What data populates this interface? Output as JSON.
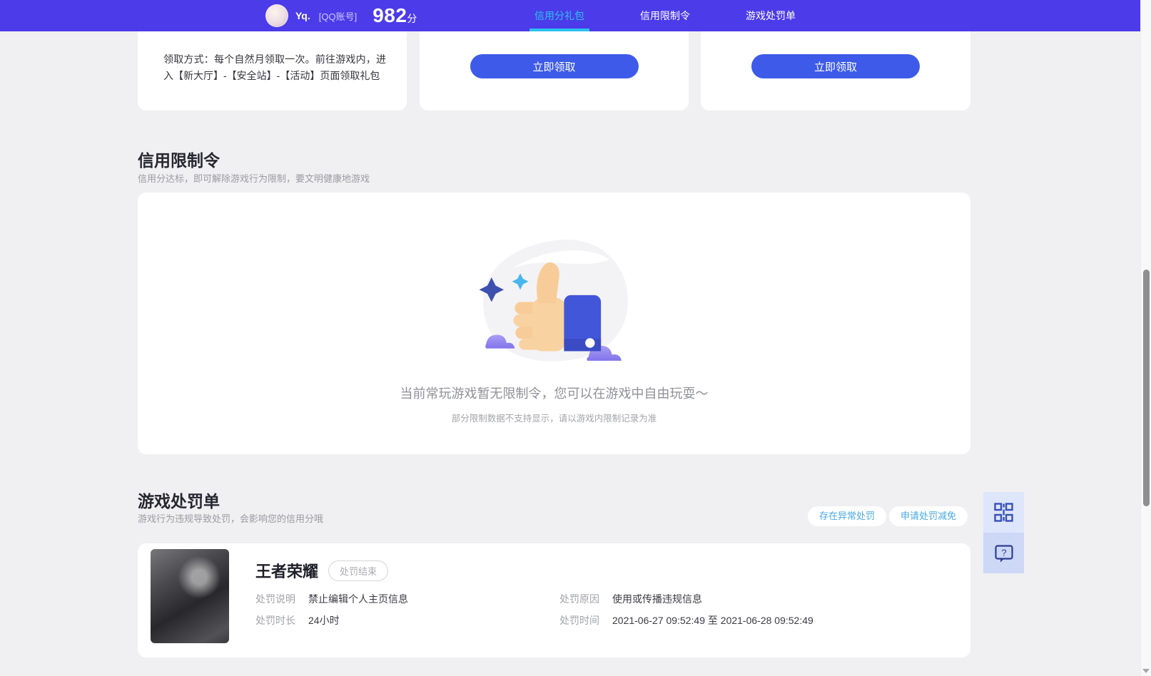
{
  "header": {
    "user": {
      "name": "Yq.",
      "account_type": "[QQ账号]",
      "score": "982",
      "score_unit": "分"
    },
    "tabs": [
      {
        "label": "信用分礼包",
        "active": true
      },
      {
        "label": "信用限制令",
        "active": false
      },
      {
        "label": "游戏处罚单",
        "active": false
      }
    ]
  },
  "gift": {
    "claim_instructions": "领取方式：每个自然月领取一次。前往游戏内，进入【新大厅】-【安全站】-【活动】页面领取礼包",
    "claim_button_label": "立即领取"
  },
  "restriction": {
    "title": "信用限制令",
    "subtitle": "信用分达标，即可解除游戏行为限制，要文明健康地游戏",
    "empty_message": "当前常玩游戏暂无限制令，您可以在游戏中自由玩耍～",
    "empty_note": "部分限制数据不支持显示，请以游戏内限制记录为准"
  },
  "penalty": {
    "title": "游戏处罚单",
    "subtitle": "游戏行为违规导致处罚，会影响您的信用分哦",
    "actions": [
      {
        "label": "存在异常处罚"
      },
      {
        "label": "申请处罚减免"
      }
    ],
    "card": {
      "game_name": "王者荣耀",
      "status_badge": "处罚结束",
      "fields": [
        {
          "label": "处罚说明",
          "value": "禁止编辑个人主页信息"
        },
        {
          "label": "处罚原因",
          "value": "使用或传播违规信息"
        },
        {
          "label": "处罚时长",
          "value": "24小时"
        },
        {
          "label": "处罚时间",
          "value": "2021-06-27 09:52:49 至 2021-06-28 09:52:49"
        }
      ]
    }
  },
  "colors": {
    "header_bg": "#4C3BE8",
    "active_tab_cyan": "#2BC2EF",
    "button_blue": "#3D5BE8",
    "link_blue": "#47A9E2"
  }
}
